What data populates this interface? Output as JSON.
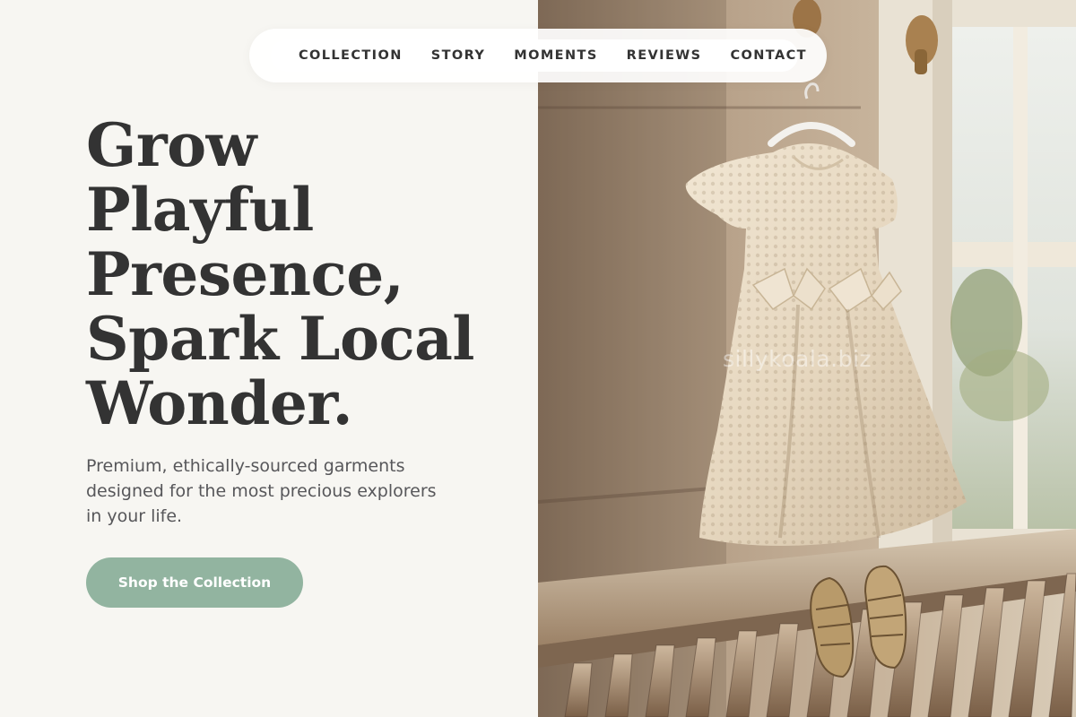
{
  "nav": {
    "items": [
      {
        "label": "COLLECTION"
      },
      {
        "label": "STORY"
      },
      {
        "label": "MOMENTS"
      },
      {
        "label": "REVIEWS"
      },
      {
        "label": "CONTACT"
      }
    ]
  },
  "hero": {
    "title_lines": [
      "Grow",
      "Playful",
      "Presence,",
      "Spark Local",
      "Wonder."
    ],
    "subtitle": "Premium, ethically-sourced garments designed for the most precious explorers in your life.",
    "cta_label": "Shop the Collection"
  },
  "photo": {
    "watermark": "sillykoala.biz"
  },
  "colors": {
    "background": "#f7f6f2",
    "text": "#333333",
    "accent": "#92b4a0",
    "nav_bg": "#ffffff"
  }
}
